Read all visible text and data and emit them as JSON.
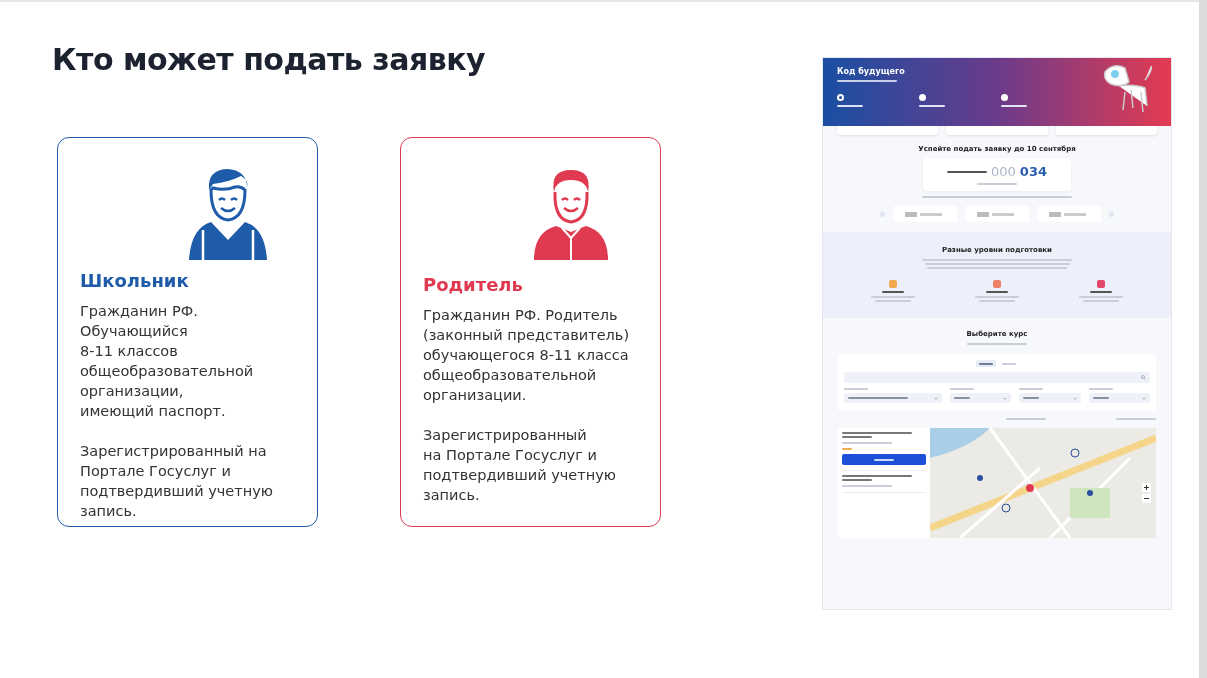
{
  "title": "Кто может подать заявку",
  "cards": [
    {
      "kind": "student",
      "heading": "Школьник",
      "color": "#1e5ba8",
      "paragraphs": [
        "Гражданин РФ.\nОбучающийся\n8-11 классов\nобщеобразовательной\nорганизации,\nимеющий паспорт.",
        "Зарегистрированный на\nПортале Госуслуг и\nподтвердивший учетную\nзапись."
      ]
    },
    {
      "kind": "parent",
      "heading": "Родитель",
      "color": "#e03a50",
      "paragraphs": [
        "Гражданин РФ. Родитель\n(законный представитель)\nобучающегося 8-11 класса\nобщеобразовательной\nорганизации.",
        "Зарегистрированный\nна  Портале Госуслуг и\nподтвердивший учетную\nзапись."
      ]
    }
  ],
  "website": {
    "header": {
      "title": "Код будущего",
      "steps": [
        {
          "selected": true
        },
        {
          "selected": false
        },
        {
          "selected": false
        }
      ]
    },
    "deadline": {
      "heading": "Успейте подать заявку до 10 сентября",
      "counter_zeros": "000",
      "counter_value": "034"
    },
    "levels": {
      "heading": "Разные уровни подготовки",
      "items": [
        {
          "color": "#f3a952"
        },
        {
          "color": "#ee8068"
        },
        {
          "color": "#e2466b"
        }
      ]
    },
    "courses": {
      "heading": "Выберите курс",
      "tabs": [
        {
          "selected": true
        },
        {
          "selected": false
        }
      ],
      "list": [
        {
          "expanded": true
        },
        {
          "expanded": false
        }
      ]
    }
  }
}
